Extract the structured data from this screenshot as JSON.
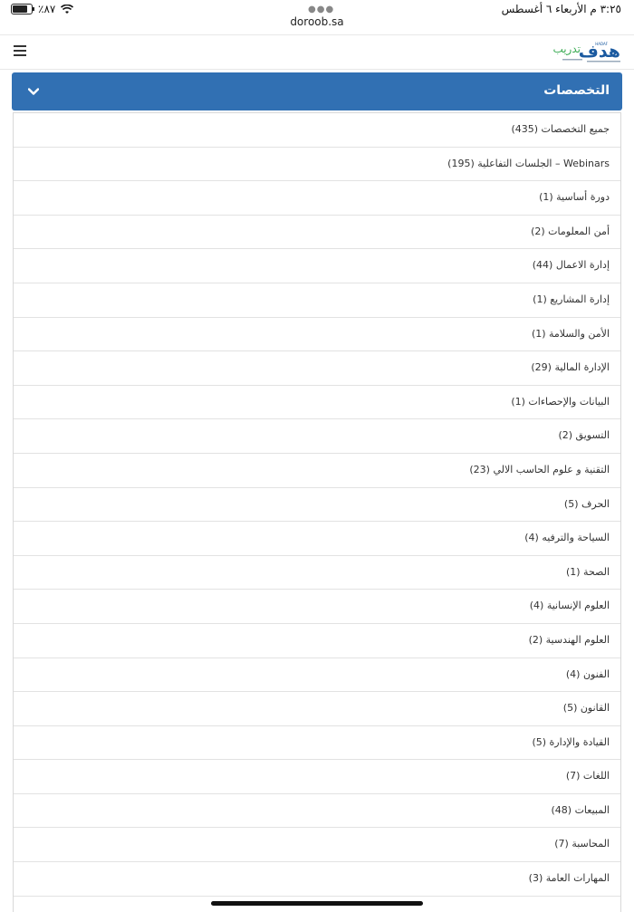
{
  "statusbar": {
    "time_date": "٣:٢٥ م  الأربعاء ٦ أغسطس",
    "battery_percent": "٪٨٧",
    "url": "doroob.sa"
  },
  "header": {
    "logo_text": "هدف",
    "logo_sub": "تدريب",
    "logo_tag": "HADAF"
  },
  "filter": {
    "title": "التخصصات"
  },
  "items": [
    {
      "label": "جميع التخصصات (435)"
    },
    {
      "label": "Webinars – الجلسات التفاعلية (195)"
    },
    {
      "label": "دورة أساسية (1)"
    },
    {
      "label": "أمن المعلومات (2)"
    },
    {
      "label": "إدارة الاعمال (44)"
    },
    {
      "label": "إدارة المشاريع (1)"
    },
    {
      "label": "الأمن والسلامة (1)"
    },
    {
      "label": "الإدارة المالية (29)"
    },
    {
      "label": "البيانات والإحصاءات (1)"
    },
    {
      "label": "التسويق (2)"
    },
    {
      "label": "التقنية و علوم الحاسب الالي (23)"
    },
    {
      "label": "الحرف (5)"
    },
    {
      "label": "السياحة والترفيه (4)"
    },
    {
      "label": "الصحة (1)"
    },
    {
      "label": "العلوم الإنسانية (4)"
    },
    {
      "label": "العلوم الهندسية (2)"
    },
    {
      "label": "الفنون (4)"
    },
    {
      "label": "القانون (5)"
    },
    {
      "label": "القيادة والإدارة (5)"
    },
    {
      "label": "اللغات (7)"
    },
    {
      "label": "المبيعات (48)"
    },
    {
      "label": "المحاسبة (7)"
    },
    {
      "label": "المهارات العامة (3)"
    }
  ]
}
